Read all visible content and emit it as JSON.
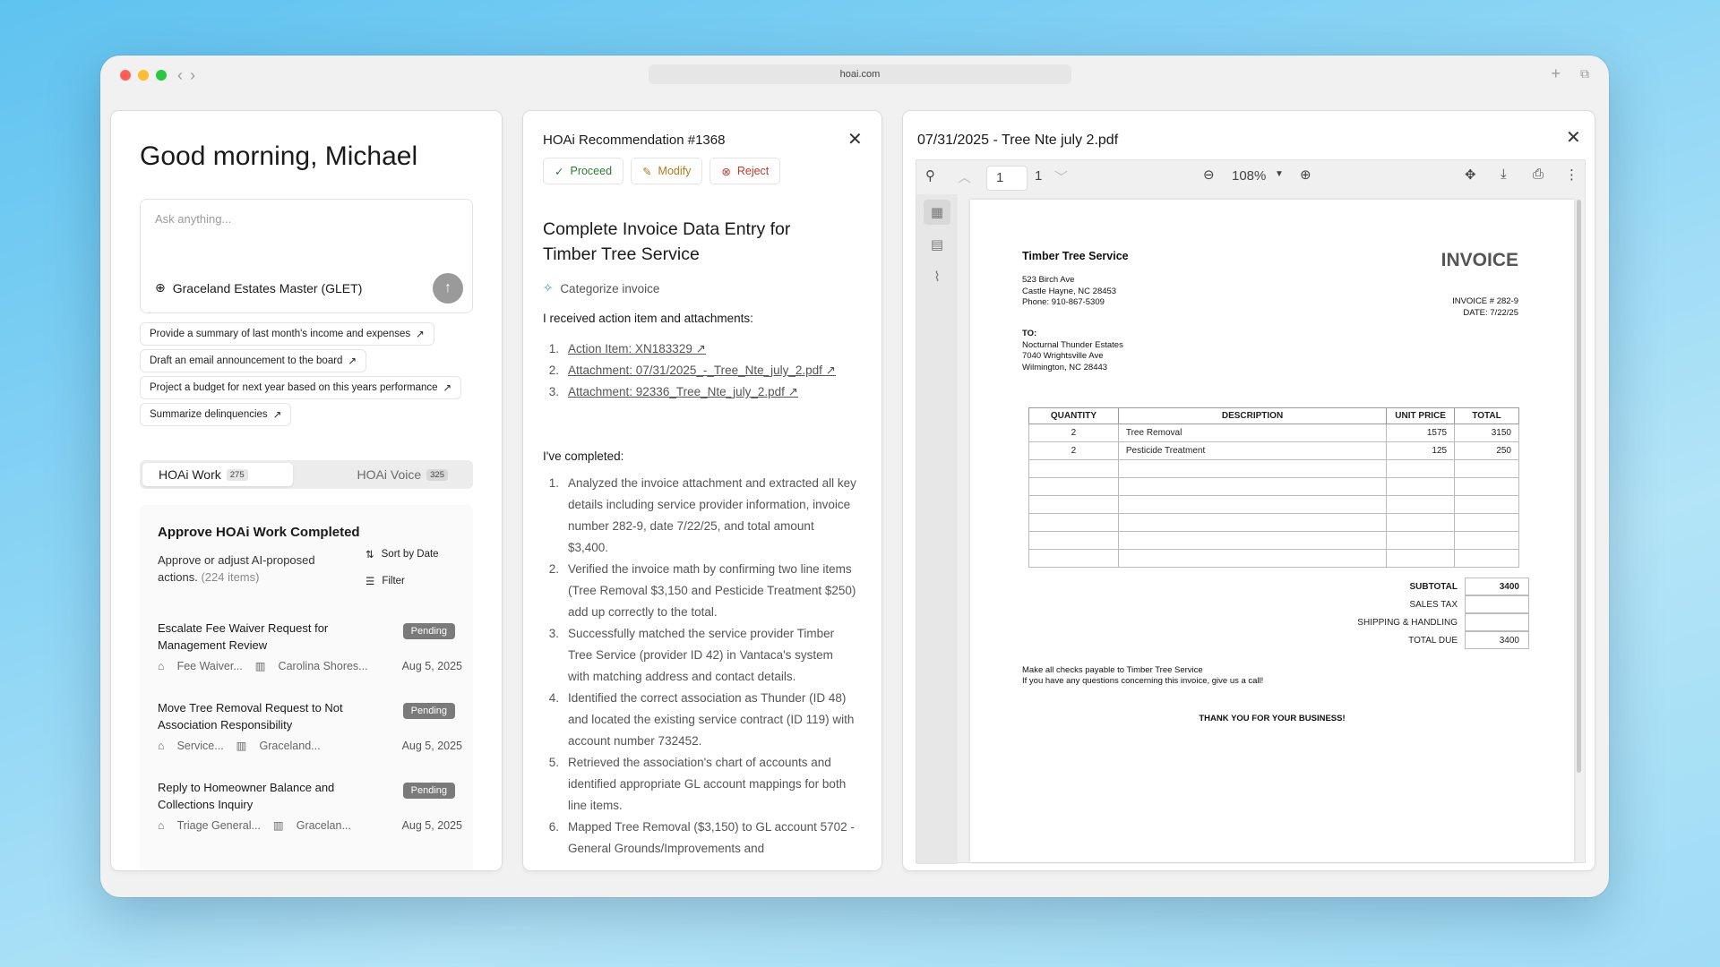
{
  "browser": {
    "url": "hoai.com"
  },
  "left": {
    "greeting": "Good morning, Michael",
    "ask_placeholder": "Ask anything...",
    "association": "Graceland Estates Master (GLET)",
    "suggestions": [
      "Provide a summary of last month's income and expenses",
      "Draft an email announcement to the board",
      "Project a budget for next year based on this years performance",
      "Summarize delinquencies"
    ],
    "tabs": [
      {
        "label": "HOAi Work",
        "count": "275"
      },
      {
        "label": "HOAi Voice",
        "count": "325"
      }
    ],
    "work": {
      "title": "Approve HOAi Work Completed",
      "desc": "Approve or adjust AI-proposed actions.",
      "desc_count": "(224 items)",
      "sort_label": "Sort by Date",
      "filter_label": "Filter",
      "items": [
        {
          "title": "Escalate Fee Waiver Request for Management Review",
          "status": "Pending",
          "tag": "Fee Waiver...",
          "assoc": "Carolina Shores...",
          "date": "Aug 5, 2025"
        },
        {
          "title": "Move Tree Removal Request to Not Association Responsibility",
          "status": "Pending",
          "tag": "Service...",
          "assoc": "Graceland...",
          "date": "Aug 5, 2025"
        },
        {
          "title": "Reply to Homeowner Balance and Collections Inquiry",
          "status": "Pending",
          "tag": "Triage General...",
          "assoc": "Gracelan...",
          "date": "Aug 5, 2025"
        }
      ]
    }
  },
  "mid": {
    "title": "HOAi Recommendation #1368",
    "buttons": {
      "proceed": "Proceed",
      "modify": "Modify",
      "reject": "Reject"
    },
    "heading": "Complete Invoice Data Entry for Timber Tree Service",
    "category": "Categorize invoice",
    "received_label": "I received action item and attachments:",
    "attachments": [
      "Action Item: XN183329 ↗",
      "Attachment: 07/31/2025_-_Tree_Nte_july_2.pdf ↗",
      "Attachment: 92336_Tree_Nte_july_2.pdf ↗"
    ],
    "completed_label": "I've completed:",
    "completed": [
      "Analyzed the invoice attachment and extracted all key details including service provider information, invoice number 282-9, date 7/22/25, and total amount $3,400.",
      "Verified the invoice math by confirming two line items (Tree Removal $3,150 and Pesticide Treatment $250) add up correctly to the total.",
      "Successfully matched the service provider Timber Tree Service (provider ID 42) in Vantaca's system with matching address and contact details.",
      "Identified the correct association as Thunder (ID 48) and located the existing service contract (ID 119) with account number 732452.",
      "Retrieved the association's chart of accounts and identified appropriate GL account mappings for both line items.",
      "Mapped Tree Removal ($3,150) to GL account 5702 - General Grounds/Improvements and"
    ]
  },
  "right": {
    "title": "07/31/2025 - Tree Nte july 2.pdf",
    "page_current": "1",
    "page_total": "1",
    "zoom": "108%",
    "invoice": {
      "company": "Timber Tree Service",
      "address": [
        "523 Birch Ave",
        "Castle Hayne, NC 28453",
        "Phone: 910-867-5309"
      ],
      "heading": "INVOICE",
      "number": "INVOICE # 282-9",
      "date": "DATE: 7/22/25",
      "to_label": "TO:",
      "to": [
        "Nocturnal Thunder Estates",
        "7040 Wrightsville Ave",
        "Wilmington, NC 28443"
      ],
      "columns": [
        "QUANTITY",
        "DESCRIPTION",
        "UNIT PRICE",
        "TOTAL"
      ],
      "rows": [
        [
          "2",
          "Tree Removal",
          "1575",
          "3150"
        ],
        [
          "2",
          "Pesticide Treatment",
          "125",
          "250"
        ],
        [
          "",
          "",
          "",
          ""
        ],
        [
          "",
          "",
          "",
          ""
        ],
        [
          "",
          "",
          "",
          ""
        ],
        [
          "",
          "",
          "",
          ""
        ],
        [
          "",
          "",
          "",
          ""
        ],
        [
          "",
          "",
          "",
          ""
        ]
      ],
      "totals": [
        {
          "label": "SUBTOTAL",
          "value": "3400",
          "bold": true
        },
        {
          "label": "SALES TAX",
          "value": ""
        },
        {
          "label": "SHIPPING & HANDLING",
          "value": ""
        },
        {
          "label": "TOTAL DUE",
          "value": "3400"
        }
      ],
      "footer1": "Make all checks payable to Timber Tree Service",
      "footer2": "If you have any questions concerning this invoice, give us a call!",
      "thanks": "THANK YOU FOR YOUR BUSINESS!"
    }
  }
}
